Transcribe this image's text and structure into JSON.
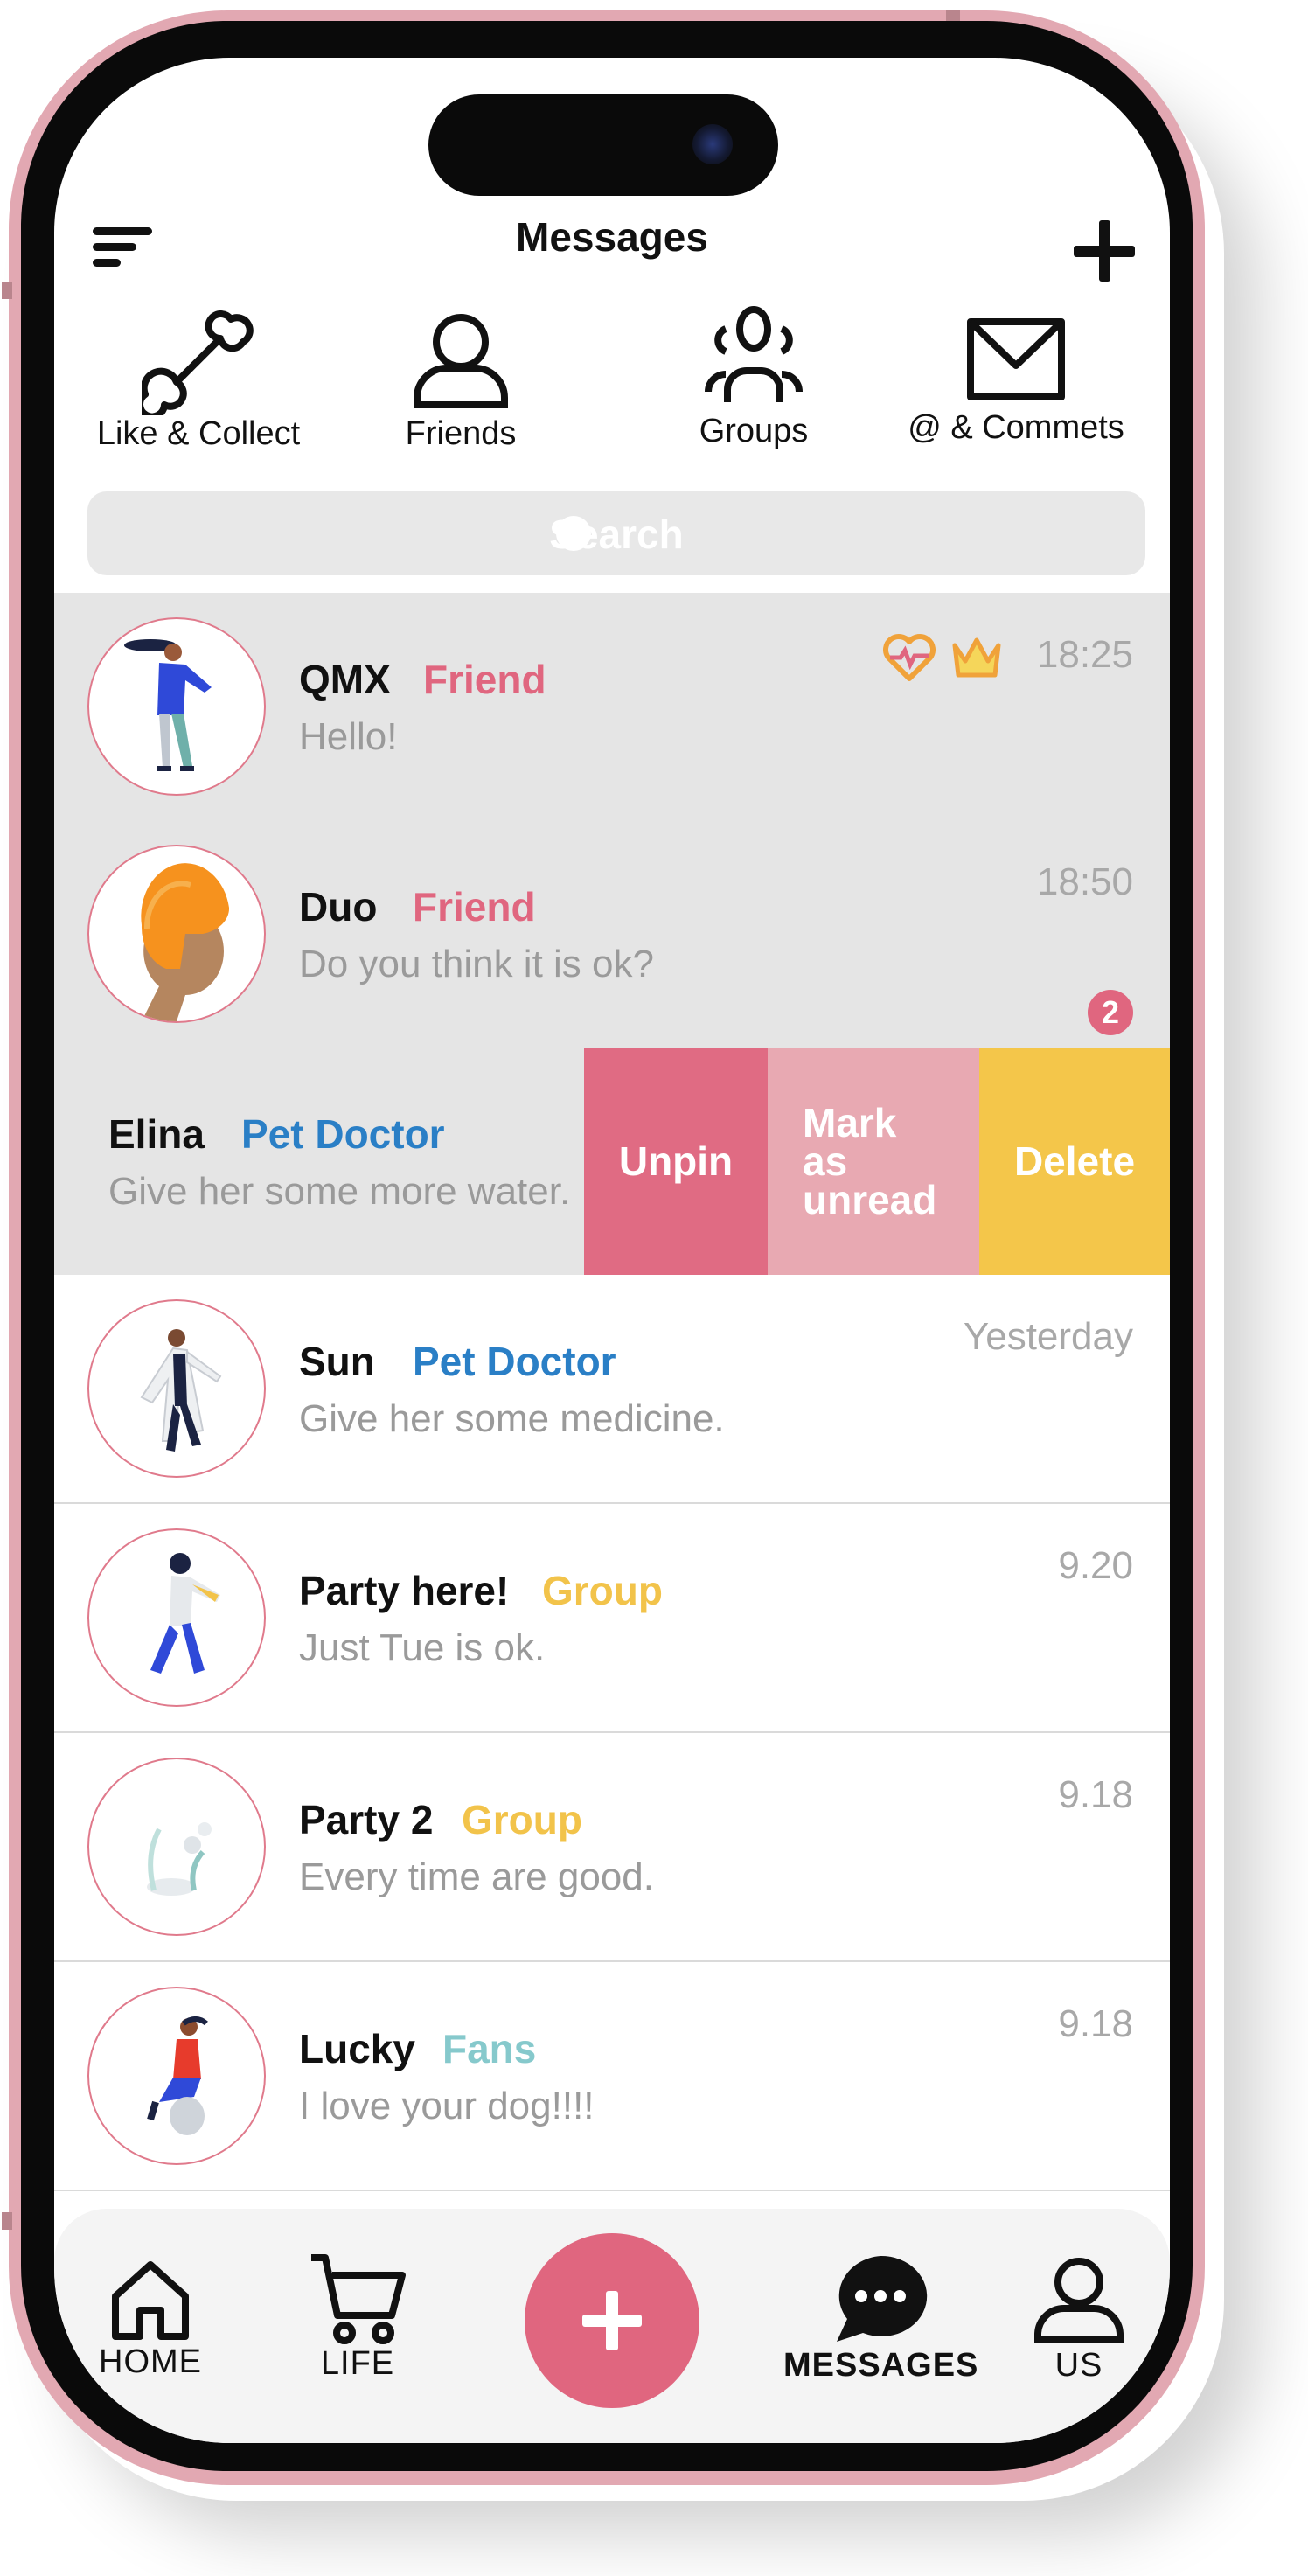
{
  "header": {
    "title": "Messages"
  },
  "categories": [
    {
      "label": "Like & Collect",
      "icon": "bone-icon"
    },
    {
      "label": "Friends",
      "icon": "person-icon"
    },
    {
      "label": "Groups",
      "icon": "group-icon"
    },
    {
      "label": "@ & Commets",
      "icon": "envelope-icon"
    }
  ],
  "search": {
    "placeholder": "Search"
  },
  "conversations": [
    {
      "name": "QMX",
      "tag": "Friend",
      "tag_color": "#e0667f",
      "preview": "Hello!",
      "time": "18:25",
      "icons": [
        "heart-pulse-icon",
        "crown-icon"
      ]
    },
    {
      "name": "Duo",
      "tag": "Friend",
      "tag_color": "#e0667f",
      "preview": "Do you think it is ok?",
      "time": "18:50",
      "unread": "2"
    },
    {
      "name": "Elina",
      "tag": "Pet Doctor",
      "tag_color": "#2a7fc6",
      "preview": "Give her some more water.",
      "actions": [
        "Unpin",
        "Mark as unread",
        "Delete"
      ]
    },
    {
      "name": "Sun",
      "tag": "Pet Doctor",
      "tag_color": "#2a7fc6",
      "preview": "Give her some medicine.",
      "time": "Yesterday"
    },
    {
      "name": "Party here!",
      "tag": "Group",
      "tag_color": "#f2c34a",
      "preview": "Just Tue is ok.",
      "time": "9.20"
    },
    {
      "name": "Party 2",
      "tag": "Group",
      "tag_color": "#f2c34a",
      "preview": "Every time are good.",
      "time": "9.18"
    },
    {
      "name": "Lucky",
      "tag": "Fans",
      "tag_color": "#86c9cc",
      "preview": "I love your dog!!!!",
      "time": "9.18"
    }
  ],
  "swipe_actions": {
    "unpin": {
      "label": "Unpin",
      "color": "#e06b83"
    },
    "mark_unread": {
      "label": "Mark as unread",
      "color": "#e8a9b2"
    },
    "delete": {
      "label": "Delete",
      "color": "#f4c64a"
    }
  },
  "tabbar": {
    "home": "HOME",
    "life": "LIFE",
    "messages": "MESSAGES",
    "us": "US",
    "accent": "#e0667f"
  }
}
